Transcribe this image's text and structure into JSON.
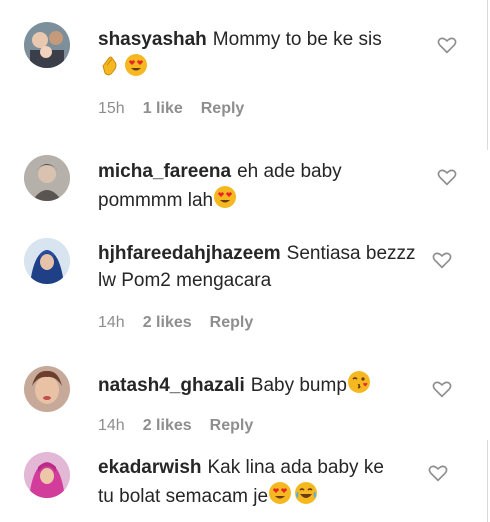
{
  "comments": [
    {
      "username": "shasyashah",
      "text": "Mommy to be ke sis",
      "emojis": [
        "clapping-hands-emoji",
        "heart-eyes-emoji"
      ],
      "time": "15h",
      "likes": "1 like",
      "reply": "Reply"
    },
    {
      "username": "micha_fareena",
      "text": "eh ade baby pommmm lah",
      "emojis": [
        "heart-eyes-emoji"
      ]
    },
    {
      "username": "hjhfareedahjhazeem",
      "text": "Sentiasa bezzz lw Pom2 mengacara",
      "time": "14h",
      "likes": "2 likes",
      "reply": "Reply"
    },
    {
      "username": "natash4_ghazali",
      "text": "Baby bump",
      "emojis": [
        "kissing-wink-emoji"
      ],
      "time": "14h",
      "likes": "2 likes",
      "reply": "Reply"
    },
    {
      "username": "ekadarwish",
      "text": "Kak lina ada baby ke tu bolat semacam je",
      "emojis": [
        "heart-eyes-emoji",
        "tears-of-joy-emoji"
      ]
    }
  ],
  "colors": {
    "text": "#262626",
    "muted": "#8e8e8e",
    "emoji_yellow": "#f5b820"
  }
}
